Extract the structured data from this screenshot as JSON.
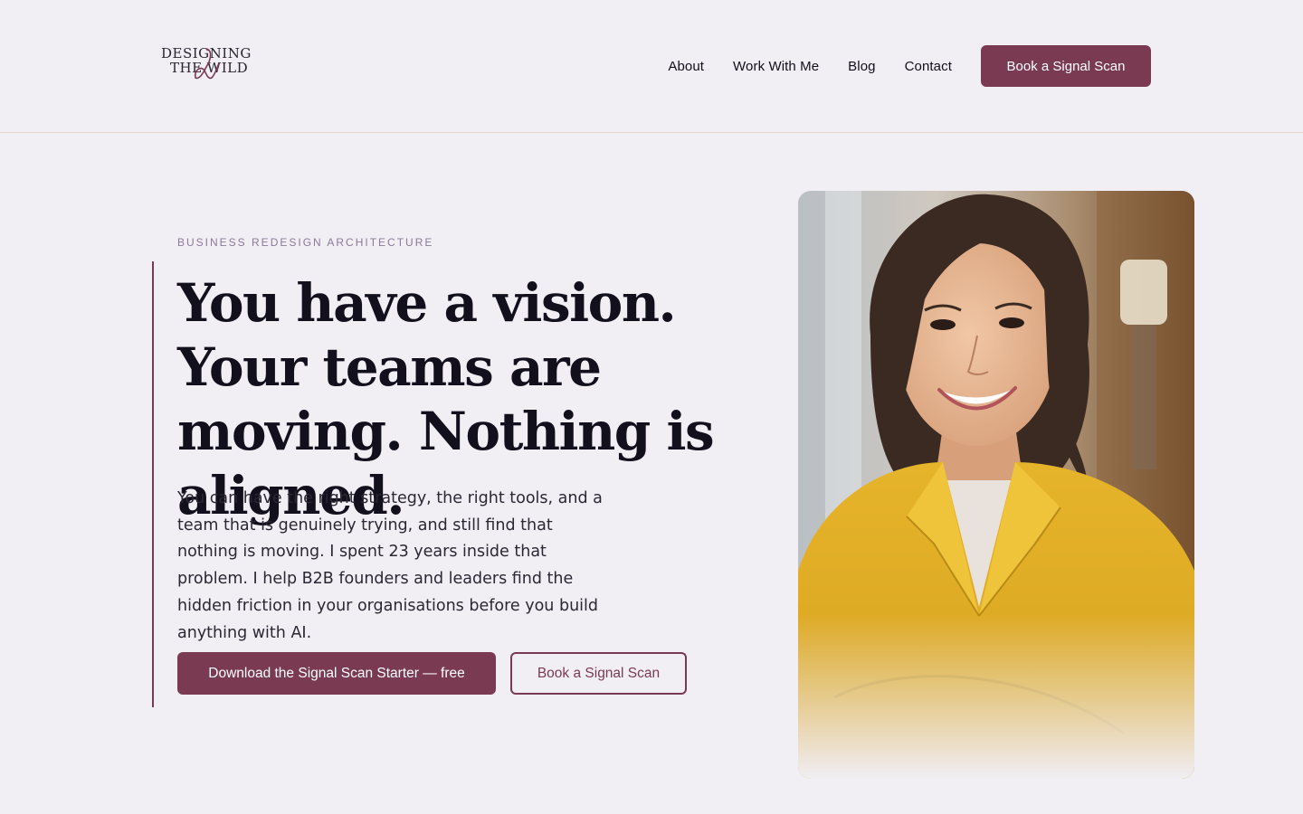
{
  "brand": {
    "logo_line1": "DESIGNING",
    "logo_line2": "THE WILD",
    "accent_color": "#7a3a52",
    "background_color": "#f1eef4"
  },
  "nav": {
    "items": [
      {
        "label": "About"
      },
      {
        "label": "Work With Me"
      },
      {
        "label": "Blog"
      },
      {
        "label": "Contact"
      }
    ],
    "cta_label": "Book a Signal Scan"
  },
  "hero": {
    "eyebrow": "BUSINESS REDESIGN ARCHITECTURE",
    "headline": "You have a vision. Your teams are moving. Nothing is aligned.",
    "body": "You can have the right strategy, the right tools, and a team that is genuinely trying, and still find that nothing is moving. I spent 23 years inside that problem. I help B2B founders and leaders find the hidden friction in your organisations before you build anything with AI.",
    "primary_cta": "Download the Signal Scan Starter — free",
    "secondary_cta": "Book a Signal Scan"
  }
}
